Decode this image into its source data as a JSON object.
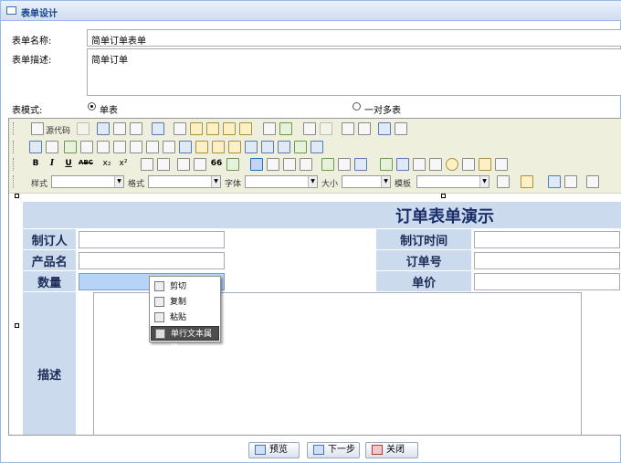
{
  "window": {
    "title": "表单设计"
  },
  "form": {
    "name_label": "表单名称:",
    "name_value": "简单订单表单",
    "desc_label": "表单描述:",
    "desc_value": "简单订单",
    "mode_label": "表模式:",
    "mode_single": "单表",
    "mode_multi": "一对多表",
    "mode_selected": "单表"
  },
  "toolbar": {
    "source_label": "源代码",
    "style_label": "样式",
    "format_label": "格式",
    "font_label": "字体",
    "size_label": "大小",
    "template_label": "模板",
    "bold_glyph": "B",
    "italic_glyph": "I",
    "underline_glyph": "U",
    "abc_glyph": "ABC",
    "sub_glyph": "x₂",
    "sup_glyph": "x²",
    "quote_glyph": "66"
  },
  "design_table": {
    "title": "订单表单演示",
    "rows": [
      {
        "label": "制订人",
        "label2": "制订时间"
      },
      {
        "label": "产品名",
        "label2": "订单号"
      },
      {
        "label": "数量",
        "label2": "单价"
      },
      {
        "label": "描述"
      }
    ]
  },
  "context_menu": {
    "items": [
      {
        "label": "剪切",
        "icon": "scissors-icon"
      },
      {
        "label": "复制",
        "icon": "copy-icon"
      },
      {
        "label": "粘贴",
        "icon": "paste-icon"
      },
      {
        "label": "单行文本属性",
        "icon": "textfield-properties-icon"
      }
    ],
    "highlighted": "单行文本属性"
  },
  "buttons": {
    "preview": "预览",
    "next": "下一步",
    "close": "关闭"
  },
  "colors": {
    "title_bar": "#cfddf0",
    "table_bg": "#ccdaee",
    "toolbar_bg": "#efefde",
    "highlight_field": "#b8d3f8"
  }
}
